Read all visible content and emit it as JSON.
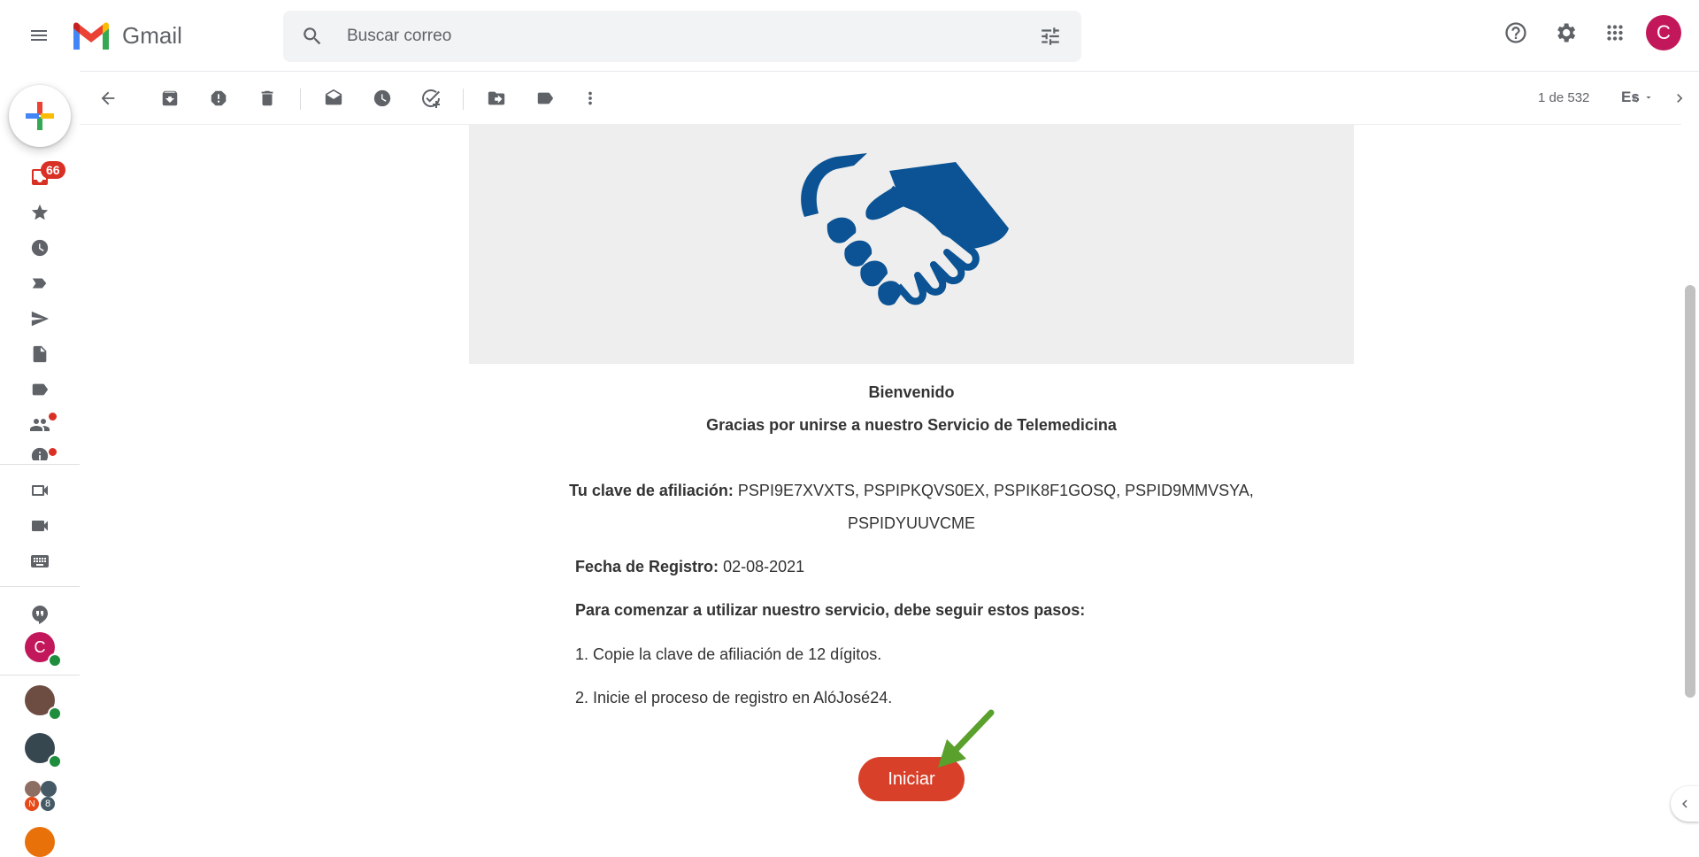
{
  "app": {
    "name": "Gmail"
  },
  "search": {
    "placeholder": "Buscar correo"
  },
  "nav": {
    "inbox_badge": "66"
  },
  "toolbar": {
    "pagination": "1 de 532",
    "language": "Es"
  },
  "email": {
    "welcome": "Bienvenido",
    "thanks": "Gracias por unirse a nuestro Servicio de Telemedicina",
    "key_label": "Tu clave de afiliación:",
    "key_values_line1": "PSPI9E7XVXTS, PSPIPKQVS0EX, PSPIK8F1GOSQ, PSPID9MMVSYA,",
    "key_values_line2": "PSPIDYUUVCME",
    "date_label": "Fecha de Registro:",
    "date_value": "02-08-2021",
    "steps_intro": "Para comenzar a utilizar nuestro servicio, debe seguir estos pasos:",
    "step1": "1. Copie la clave de afiliación de 12 dígitos.",
    "step2": "2. Inicie el proceso de registro en AlóJosé24.",
    "cta_label": "Iniciar"
  },
  "user": {
    "avatar_initial": "C"
  },
  "contacts": {
    "c1_initial": "C",
    "group_count": "8",
    "group_initial": "N"
  },
  "colors": {
    "accent_red": "#d9402a",
    "avatar_pink": "#c2185b",
    "handshake_blue": "#0b5394"
  }
}
